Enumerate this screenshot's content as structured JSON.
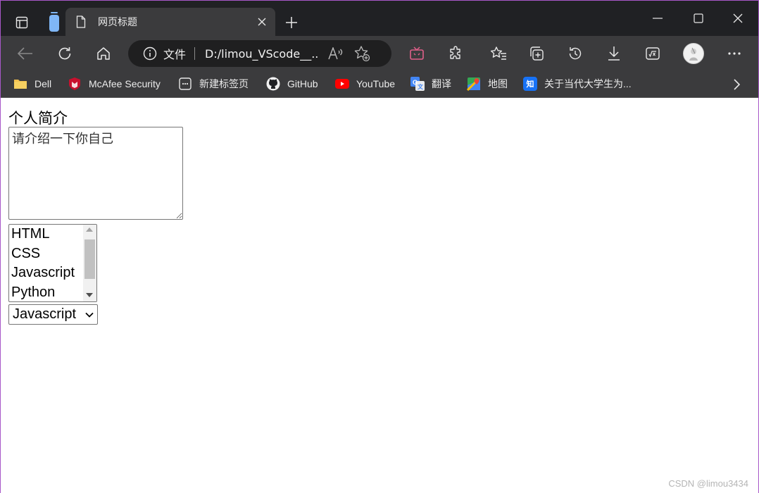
{
  "browser": {
    "tab": {
      "title": "网页标题"
    },
    "address": {
      "protocol_label": "文件",
      "url": "D:/limou_VScode__..."
    }
  },
  "bookmarks": [
    {
      "label": "Dell",
      "icon": "folder-icon"
    },
    {
      "label": "McAfee Security",
      "icon": "mcafee-icon"
    },
    {
      "label": "新建标签页",
      "icon": "new-tab-icon"
    },
    {
      "label": "GitHub",
      "icon": "github-icon"
    },
    {
      "label": "YouTube",
      "icon": "youtube-icon"
    },
    {
      "label": "翻译",
      "icon": "translate-icon"
    },
    {
      "label": "地图",
      "icon": "map-icon"
    },
    {
      "label": "关于当代大学生为...",
      "icon": "zhihu-icon"
    }
  ],
  "page": {
    "heading": "个人简介",
    "textarea_placeholder": "请介绍一下你自己",
    "list_options": [
      "HTML",
      "CSS",
      "Javascript",
      "Python"
    ],
    "dropdown_value": "Javascript"
  },
  "watermark": "CSDN @limou3434",
  "colors": {
    "titlebar": "#202124",
    "toolbar": "#3b3b3d",
    "addressbar": "#1f1f20",
    "window_border": "#a857c9"
  }
}
